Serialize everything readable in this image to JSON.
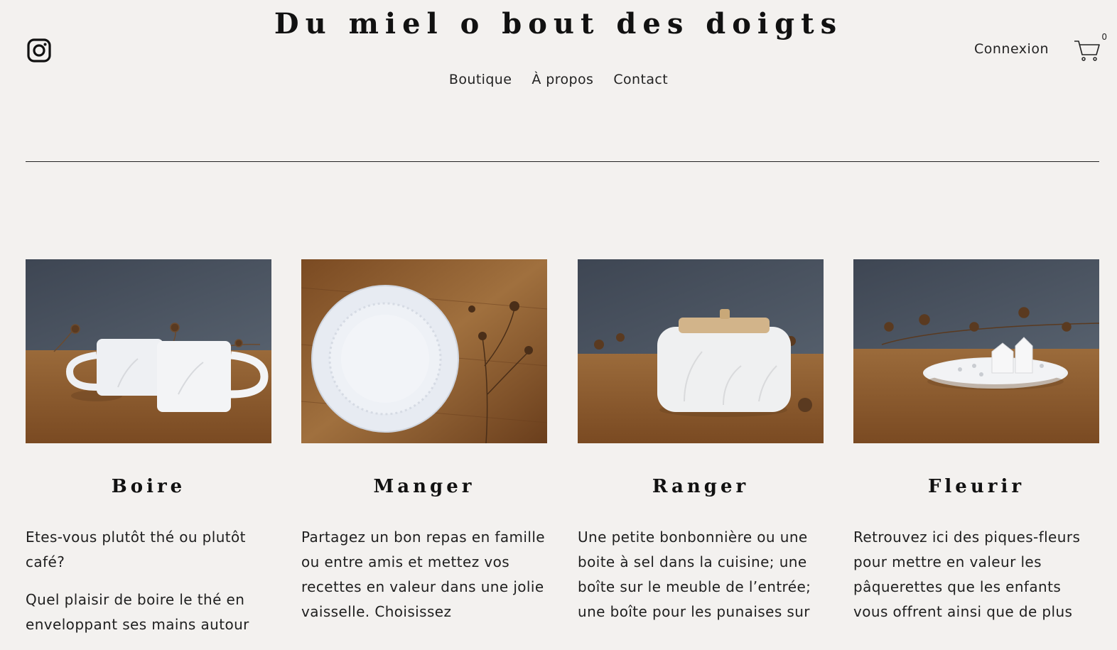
{
  "header": {
    "site_title": "Du miel o bout des doigts",
    "login_label": "Connexion",
    "cart_count": "0",
    "icons": [
      "instagram-icon",
      "cart-icon"
    ]
  },
  "nav": {
    "items": [
      {
        "label": "Boutique"
      },
      {
        "label": "À propos"
      },
      {
        "label": "Contact"
      }
    ]
  },
  "categories": [
    {
      "title": "Boire",
      "image": "mugs-photo",
      "paragraphs": [
        "Etes-vous plutôt thé ou plutôt café?",
        "Quel plaisir de boire le thé en enveloppant ses mains autour"
      ]
    },
    {
      "title": "Manger",
      "image": "plates-photo",
      "paragraphs": [
        "Partagez un bon repas en famille ou entre amis et mettez vos recettes en valeur dans une jolie vaisselle. Choisissez"
      ]
    },
    {
      "title": "Ranger",
      "image": "jar-photo",
      "paragraphs": [
        "Une petite bonbonnière ou une boite à sel dans la cuisine; une boîte sur le meuble de l’entrée; une boîte pour les punaises sur"
      ]
    },
    {
      "title": "Fleurir",
      "image": "flower-holder-photo",
      "paragraphs": [
        "Retrouvez ici des piques-fleurs pour mettre en valeur les pâquerettes que les enfants vous offrent ainsi que de plus"
      ]
    }
  ],
  "colors": {
    "background": "#f3f1ef",
    "text": "#1a1a1a",
    "wall": "#4a5360",
    "wood": "#8a5a2e"
  }
}
